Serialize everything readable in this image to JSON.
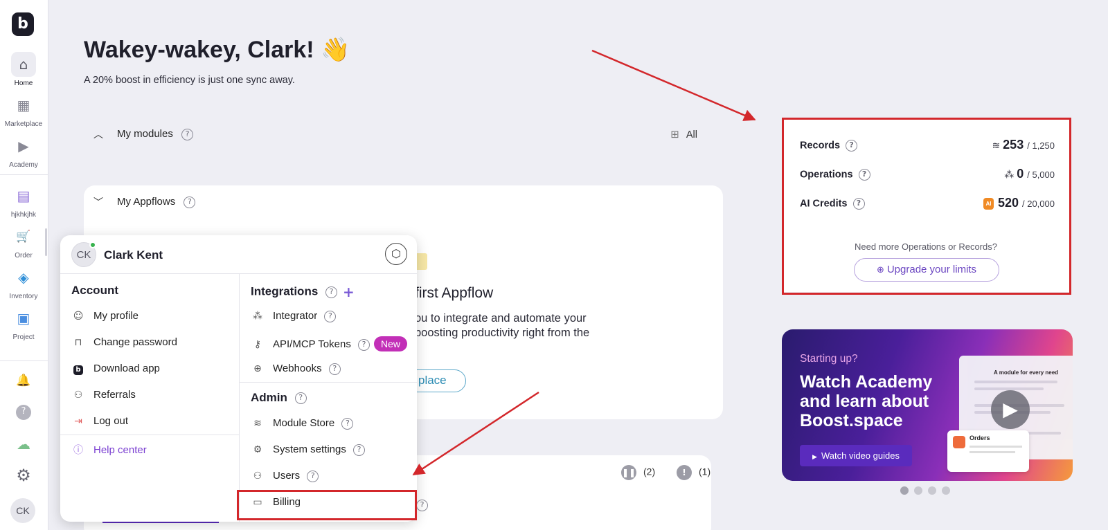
{
  "sidebar": {
    "logo": "b",
    "items": [
      {
        "label": "Home",
        "icon": "home-icon",
        "glyph": "⌂",
        "active": true
      },
      {
        "label": "Marketplace",
        "icon": "store-icon",
        "glyph": "▦"
      },
      {
        "label": "Academy",
        "icon": "play-icon",
        "glyph": "▶"
      },
      {
        "label": "hjkhkjhk",
        "icon": "book-icon",
        "glyph": "▤"
      },
      {
        "label": "Order",
        "icon": "cart-icon",
        "glyph": "🛒"
      },
      {
        "label": "Inventory",
        "icon": "box-icon",
        "glyph": "◈"
      },
      {
        "label": "Project",
        "icon": "clipboard-icon",
        "glyph": "▣"
      }
    ],
    "bottom_icons": [
      {
        "icon": "bell-icon",
        "glyph": "🔔"
      },
      {
        "icon": "question-icon",
        "glyph": "?"
      },
      {
        "icon": "cloud-check-icon",
        "glyph": "☁"
      },
      {
        "icon": "gear-icon",
        "glyph": "⚙"
      }
    ],
    "avatar": "CK"
  },
  "main": {
    "greeting": "Wakey-wakey, Clark! 👋",
    "subtitle": "A 20% boost in efficiency is just one sync away.",
    "my_modules": {
      "label": "My modules",
      "all_label": "All"
    },
    "my_appflows": {
      "label": "My Appflows",
      "heading": "first Appflow",
      "text": "ou to integrate and automate your boosting productivity right from the",
      "button": "place"
    },
    "stats": {
      "paused": "(2)",
      "errors": "(1)"
    }
  },
  "limits": {
    "records": {
      "label": "Records",
      "value": "253",
      "max": "/ 1,250"
    },
    "operations": {
      "label": "Operations",
      "value": "0",
      "max": "/ 5,000"
    },
    "ai_credits": {
      "label": "AI Credits",
      "value": "520",
      "max": "/ 20,000",
      "badge": "AI"
    },
    "need_more": "Need more Operations or Records?",
    "upgrade": "Upgrade your limits"
  },
  "banner": {
    "starting": "Starting up?",
    "title": "Watch Academy and learn about Boost.space",
    "button": "Watch video guides",
    "shot_title": "A module for every need",
    "order_label": "Orders"
  },
  "menu": {
    "avatar": "CK",
    "name": "Clark Kent",
    "account": {
      "title": "Account",
      "items": [
        "My profile",
        "Change password",
        "Download app",
        "Referrals",
        "Log out"
      ],
      "help": "Help center"
    },
    "integrations": {
      "title": "Integrations",
      "items": [
        "Integrator",
        "API/MCP Tokens",
        "Webhooks"
      ],
      "new_badge": "New"
    },
    "admin": {
      "title": "Admin",
      "items": [
        "Module Store",
        "System settings",
        "Users",
        "Billing"
      ]
    }
  },
  "colors": {
    "accent": "#6b46c1",
    "highlight": "#d3272b",
    "badge": "#c22fb7"
  }
}
